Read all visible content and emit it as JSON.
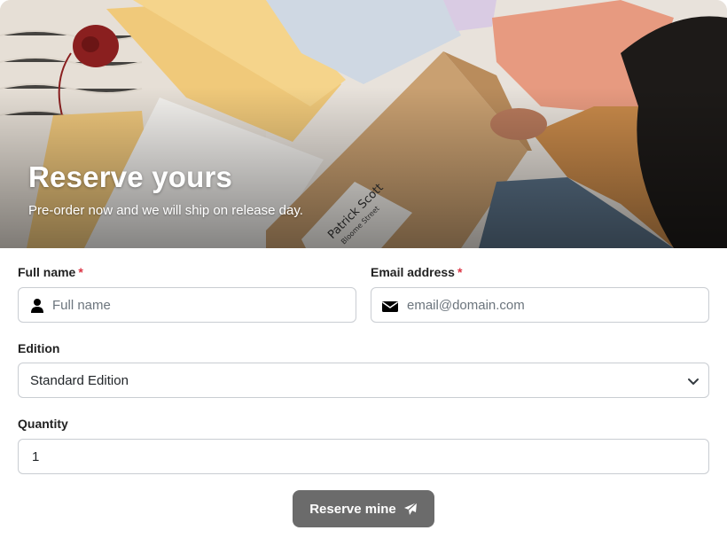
{
  "hero": {
    "title": "Reserve yours",
    "subtitle": "Pre-order now and we will ship on release day.",
    "image_description_icon": "photo-packages"
  },
  "form": {
    "full_name": {
      "label": "Full name",
      "required_mark": "*",
      "placeholder": "Full name",
      "icon": "user-icon"
    },
    "email": {
      "label": "Email address",
      "required_mark": "*",
      "placeholder": "email@domain.com",
      "icon": "envelope-icon"
    },
    "edition": {
      "label": "Edition",
      "selected": "Standard Edition",
      "icon": "chevron-down-icon"
    },
    "quantity": {
      "label": "Quantity",
      "value": "1"
    },
    "submit": {
      "label": "Reserve mine",
      "icon": "paper-plane-icon"
    }
  },
  "colors": {
    "required": "#dc3545",
    "button_bg": "#6b6b6b",
    "border": "#c9cdd2"
  }
}
